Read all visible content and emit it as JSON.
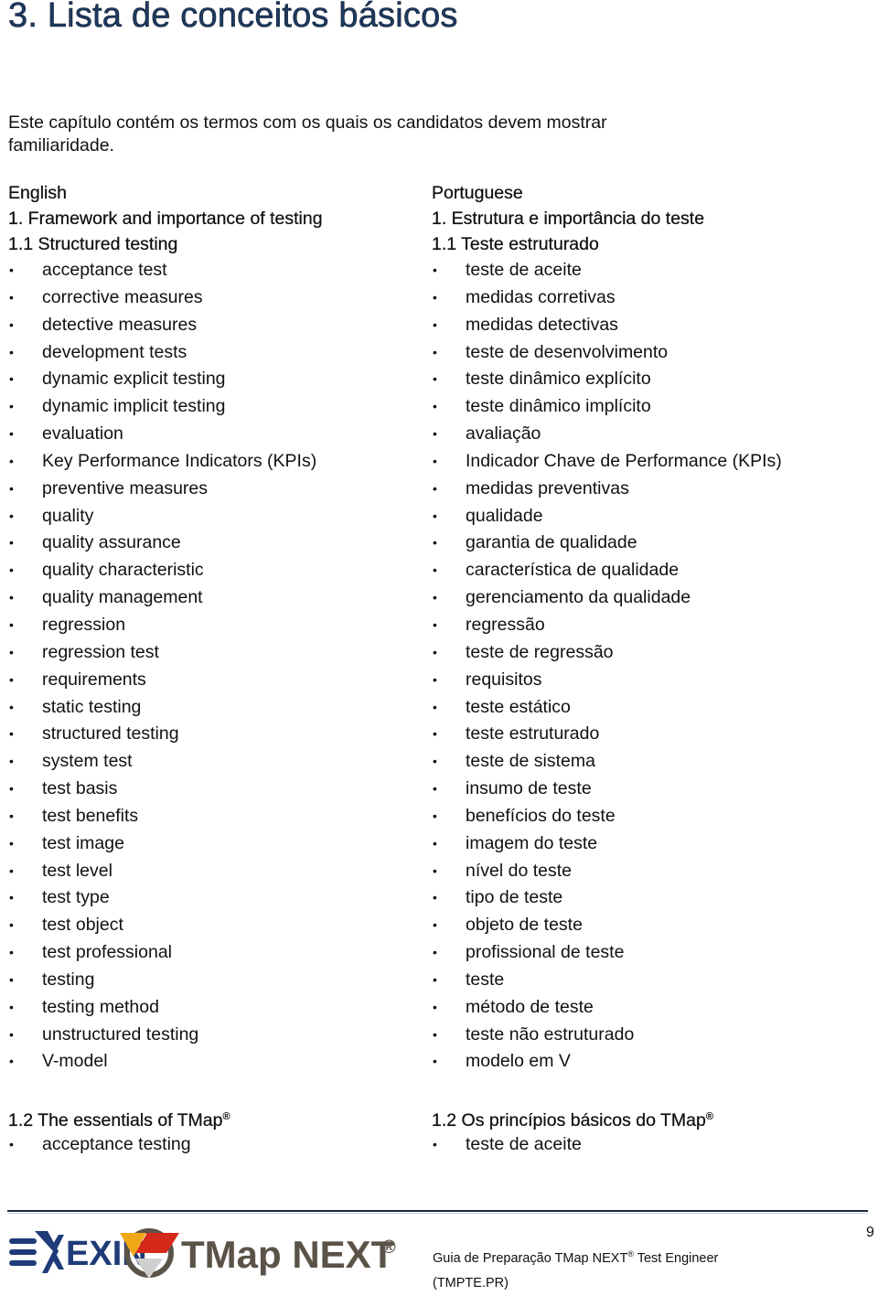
{
  "document": {
    "title": "3. Lista de conceitos básicos",
    "intro": "Este capítulo contém os termos com os quais os candidatos devem mostrar familiaridade."
  },
  "english": {
    "language": "English",
    "chapter": "1. Framework and importance of testing",
    "section_1_1": "1.1 Structured testing",
    "terms": [
      "acceptance test",
      "corrective measures",
      "detective measures",
      "development tests",
      "dynamic explicit testing",
      "dynamic implicit testing",
      "evaluation",
      "Key Performance Indicators (KPIs)",
      "preventive measures",
      "quality",
      "quality assurance",
      "quality characteristic",
      "quality management",
      "regression",
      "regression test",
      "requirements",
      "static testing",
      "structured testing",
      "system test",
      "test basis",
      "test benefits",
      "test image",
      "test level",
      "test type",
      "test object",
      "test professional",
      "testing",
      "testing method",
      "unstructured testing",
      "V-model"
    ],
    "section_1_2": "1.2 The essentials of TMap",
    "section_1_2_mark": "®",
    "section_1_2_terms": [
      "acceptance testing"
    ]
  },
  "portuguese": {
    "language": "Portuguese",
    "chapter": "1. Estrutura e importância do teste",
    "section_1_1": "1.1 Teste estruturado",
    "terms": [
      "teste de aceite",
      "medidas corretivas",
      "medidas detectivas",
      "teste de desenvolvimento",
      "teste dinâmico explícito",
      "teste dinâmico implícito",
      "avaliação",
      "Indicador Chave de Performance (KPIs)",
      "medidas preventivas",
      "qualidade",
      "garantia de qualidade",
      "característica de qualidade",
      "gerenciamento da qualidade",
      "regressão",
      "teste de regressão",
      "requisitos",
      "teste estático",
      "teste estruturado",
      "teste de sistema",
      "insumo de teste",
      "benefícios do teste",
      "imagem do teste",
      "nível do teste",
      "tipo de teste",
      "objeto de teste",
      "profissional de teste",
      "teste",
      "método de teste",
      "teste não estruturado",
      "modelo em V"
    ],
    "section_1_2": "1.2  Os princípios básicos do TMap",
    "section_1_2_mark": "®",
    "section_1_2_terms": [
      "teste de aceite"
    ]
  },
  "bullet_glyph": "•",
  "footer": {
    "logo_exin": "EXIN",
    "logo_tmap": "TMap NEXT",
    "logo_mark": "®",
    "guide_prefix": "Guia de Preparação TMap NEXT",
    "guide_mark": "®",
    "guide_suffix": " Test Engineer",
    "guide_code": "(TMPTE.PR)",
    "page_number": "9"
  },
  "colors": {
    "title": "#1f3a5f",
    "exin_blue": "#1f3b78",
    "tmap_gray": "#5b5348",
    "logo_orange": "#f0a818",
    "logo_red": "#d52a1a",
    "logo_light_gray": "#cfcfcf",
    "rule": "#1b2940"
  }
}
